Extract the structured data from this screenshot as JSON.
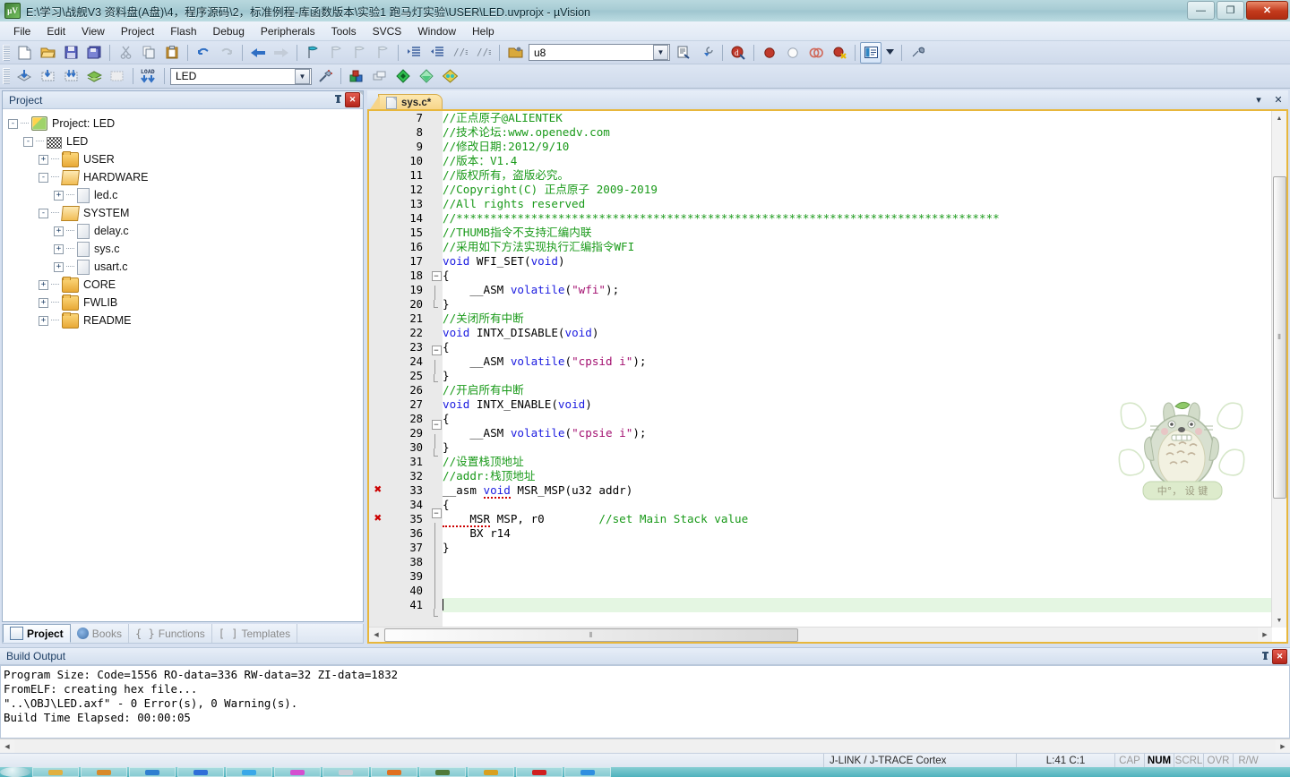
{
  "window": {
    "title": "E:\\学习\\战舰V3 资料盘(A盘)\\4，程序源码\\2，标准例程-库函数版本\\实验1 跑马灯实验\\USER\\LED.uvprojx - µVision",
    "app_icon": "uvision-logo-icon",
    "minimize_label": "—",
    "restore_label": "❐",
    "close_label": "✕"
  },
  "menu": {
    "items": [
      "File",
      "Edit",
      "View",
      "Project",
      "Flash",
      "Debug",
      "Peripherals",
      "Tools",
      "SVCS",
      "Window",
      "Help"
    ]
  },
  "toolbar_row1": {
    "groups": [
      {
        "buttons": [
          {
            "name": "new-file-icon",
            "glyph": "📄"
          },
          {
            "name": "open-file-icon",
            "glyph": "📂"
          },
          {
            "name": "save-icon",
            "glyph": "💾"
          },
          {
            "name": "save-all-icon",
            "glyph": "🗄"
          }
        ]
      },
      {
        "buttons": [
          {
            "name": "cut-icon",
            "glyph": "✂"
          },
          {
            "name": "copy-icon",
            "glyph": "⧉"
          },
          {
            "name": "paste-icon",
            "glyph": "📋"
          }
        ]
      },
      {
        "buttons": [
          {
            "name": "undo-icon",
            "glyph": "↶"
          },
          {
            "name": "redo-icon",
            "glyph": "↷"
          }
        ]
      },
      {
        "buttons": [
          {
            "name": "navigate-back-icon",
            "glyph": "⬅"
          },
          {
            "name": "navigate-forward-icon",
            "glyph": "➡"
          }
        ]
      },
      {
        "buttons": [
          {
            "name": "bookmark-toggle-icon",
            "glyph": "⚑"
          },
          {
            "name": "bookmark-prev-icon",
            "glyph": "⚐"
          },
          {
            "name": "bookmark-next-icon",
            "glyph": "⚐"
          },
          {
            "name": "bookmark-clear-icon",
            "glyph": "⚐"
          }
        ]
      },
      {
        "buttons": [
          {
            "name": "indent-icon",
            "glyph": "⇥"
          },
          {
            "name": "outdent-icon",
            "glyph": "⇤"
          },
          {
            "name": "comment-icon",
            "glyph": "//"
          },
          {
            "name": "uncomment-icon",
            "glyph": "//"
          }
        ]
      }
    ]
  },
  "toolbar_row2": {
    "buttons_left": [
      {
        "name": "build-icon",
        "glyph": "⬒"
      },
      {
        "name": "rebuild-icon",
        "glyph": "⬓"
      },
      {
        "name": "batch-build-icon",
        "glyph": "⬔"
      },
      {
        "name": "translate-icon",
        "glyph": "📚"
      },
      {
        "name": "stop-build-icon",
        "glyph": "⬛"
      }
    ],
    "load_button": {
      "name": "download-to-flash-icon",
      "label": "LOAD"
    },
    "target_combo": {
      "name": "target-select",
      "value": "LED"
    },
    "buttons_right": [
      {
        "name": "target-options-icon",
        "glyph": "🛠"
      },
      {
        "name": "manage-project-items-icon",
        "glyph": "▦"
      },
      {
        "name": "manage-multi-project-icon",
        "glyph": "❏"
      },
      {
        "name": "pack-installer-icon",
        "glyph": "◈"
      },
      {
        "name": "manage-run-time-env-icon",
        "glyph": "◇"
      },
      {
        "name": "select-software-packs-icon",
        "glyph": "◆"
      }
    ],
    "divider_right": [
      {
        "name": "open-folder-icon",
        "glyph": "📁"
      }
    ],
    "search_combo": {
      "name": "find-combo",
      "value": "u8"
    },
    "after_search": [
      {
        "name": "find-in-files-icon",
        "glyph": "🔎"
      },
      {
        "name": "incremental-find-icon",
        "glyph": "🔍"
      }
    ],
    "debug_group": [
      {
        "name": "start-debug-session-icon",
        "glyph": "🅓"
      }
    ],
    "breakpoint_group": [
      {
        "name": "insert-remove-breakpoint-icon",
        "glyph": "●",
        "color": "#cc2222"
      },
      {
        "name": "enable-disable-breakpoint-icon",
        "glyph": "○",
        "color": "#ffffff"
      },
      {
        "name": "disable-all-breakpoints-icon",
        "glyph": "◍",
        "color": "#dd5555"
      },
      {
        "name": "kill-all-breakpoints-icon",
        "glyph": "●",
        "color": "#cc2222"
      }
    ],
    "window_group": [
      {
        "name": "project-window-toggle-icon",
        "glyph": "▤",
        "active": true
      },
      {
        "name": "window-dropdown-icon",
        "glyph": "▾"
      },
      {
        "name": "configuration-wizard-icon",
        "glyph": "🔧"
      }
    ]
  },
  "project_panel": {
    "title": "Project",
    "pin_label": "📌",
    "close_label": "✕",
    "tree": [
      {
        "depth": 0,
        "expander": "-",
        "icon": "project-icon",
        "label": "Project: LED"
      },
      {
        "depth": 1,
        "expander": "-",
        "icon": "target-icon",
        "label": "LED"
      },
      {
        "depth": 2,
        "expander": "+",
        "icon": "folder-icon",
        "label": "USER"
      },
      {
        "depth": 2,
        "expander": "-",
        "icon": "folder-open-icon",
        "label": "HARDWARE"
      },
      {
        "depth": 3,
        "expander": "+",
        "icon": "c-file-icon",
        "label": "led.c"
      },
      {
        "depth": 2,
        "expander": "-",
        "icon": "folder-open-icon",
        "label": "SYSTEM"
      },
      {
        "depth": 3,
        "expander": "+",
        "icon": "c-file-icon",
        "label": "delay.c"
      },
      {
        "depth": 3,
        "expander": "+",
        "icon": "c-file-icon",
        "label": "sys.c"
      },
      {
        "depth": 3,
        "expander": "+",
        "icon": "c-file-icon",
        "label": "usart.c"
      },
      {
        "depth": 2,
        "expander": "+",
        "icon": "folder-icon",
        "label": "CORE"
      },
      {
        "depth": 2,
        "expander": "+",
        "icon": "folder-icon",
        "label": "FWLIB"
      },
      {
        "depth": 2,
        "expander": "+",
        "icon": "folder-icon",
        "label": "README"
      }
    ],
    "tabs": [
      {
        "label": "Project",
        "icon": "project-tab-icon",
        "selected": true
      },
      {
        "label": "Books",
        "icon": "books-tab-icon",
        "selected": false
      },
      {
        "label": "Functions",
        "icon": "functions-tab-icon",
        "prefix": "{ }",
        "selected": false
      },
      {
        "label": "Templates",
        "icon": "templates-tab-icon",
        "prefix": "[ ]",
        "selected": false
      }
    ]
  },
  "editor": {
    "tab": {
      "label": "sys.c*",
      "icon": "c-file-icon"
    },
    "dropdown_label": "▾",
    "close_label": "✕",
    "watermark": {
      "name": "totoro-watermark",
      "caption": "中°， 设 键"
    },
    "first_line_number": 7,
    "highlight_line": 41,
    "error_marker_lines": [
      33,
      35
    ],
    "lines": [
      {
        "n": 7,
        "fold": "",
        "segs": [
          {
            "t": "//正点原子@ALIENTEK",
            "c": "cmt"
          }
        ]
      },
      {
        "n": 8,
        "fold": "",
        "segs": [
          {
            "t": "//技术论坛:www.openedv.com",
            "c": "cmt"
          }
        ]
      },
      {
        "n": 9,
        "fold": "",
        "segs": [
          {
            "t": "//修改日期:2012/9/10",
            "c": "cmt"
          }
        ]
      },
      {
        "n": 10,
        "fold": "",
        "segs": [
          {
            "t": "//版本：V1.4",
            "c": "cmt"
          }
        ]
      },
      {
        "n": 11,
        "fold": "",
        "segs": [
          {
            "t": "//版权所有，盗版必究。",
            "c": "cmt"
          }
        ]
      },
      {
        "n": 12,
        "fold": "",
        "segs": [
          {
            "t": "//Copyright(C) 正点原子 2009-2019",
            "c": "cmt"
          }
        ]
      },
      {
        "n": 13,
        "fold": "",
        "segs": [
          {
            "t": "//All rights reserved",
            "c": "cmt"
          }
        ]
      },
      {
        "n": 14,
        "fold": "",
        "segs": [
          {
            "t": "//********************************************************************************",
            "c": "cmt"
          }
        ]
      },
      {
        "n": 15,
        "fold": "",
        "segs": [
          {
            "t": "//THUMB指令不支持汇编内联",
            "c": "cmt"
          }
        ]
      },
      {
        "n": 16,
        "fold": "",
        "segs": [
          {
            "t": "//采用如下方法实现执行汇编指令WFI",
            "c": "cmt"
          }
        ]
      },
      {
        "n": 17,
        "fold": "",
        "segs": [
          {
            "t": "void",
            "c": "kw"
          },
          {
            "t": " WFI_SET(",
            "c": "pln"
          },
          {
            "t": "void",
            "c": "kw"
          },
          {
            "t": ")",
            "c": "pln"
          }
        ]
      },
      {
        "n": 18,
        "fold": "box",
        "segs": [
          {
            "t": "{",
            "c": "pln"
          }
        ]
      },
      {
        "n": 19,
        "fold": "bar",
        "segs": [
          {
            "t": "    __ASM ",
            "c": "pln"
          },
          {
            "t": "volatile",
            "c": "kw"
          },
          {
            "t": "(",
            "c": "pln"
          },
          {
            "t": "\"wfi\"",
            "c": "str"
          },
          {
            "t": ");",
            "c": "pln"
          }
        ]
      },
      {
        "n": 20,
        "fold": "end",
        "segs": [
          {
            "t": "}",
            "c": "pln"
          }
        ]
      },
      {
        "n": 21,
        "fold": "",
        "segs": [
          {
            "t": "//关闭所有中断",
            "c": "cmt"
          }
        ]
      },
      {
        "n": 22,
        "fold": "",
        "segs": [
          {
            "t": "void",
            "c": "kw"
          },
          {
            "t": " INTX_DISABLE(",
            "c": "pln"
          },
          {
            "t": "void",
            "c": "kw"
          },
          {
            "t": ")",
            "c": "pln"
          }
        ]
      },
      {
        "n": 23,
        "fold": "box",
        "segs": [
          {
            "t": "{",
            "c": "pln"
          }
        ]
      },
      {
        "n": 24,
        "fold": "bar",
        "segs": [
          {
            "t": "    __ASM ",
            "c": "pln"
          },
          {
            "t": "volatile",
            "c": "kw"
          },
          {
            "t": "(",
            "c": "pln"
          },
          {
            "t": "\"cpsid i\"",
            "c": "str"
          },
          {
            "t": ");",
            "c": "pln"
          }
        ]
      },
      {
        "n": 25,
        "fold": "end",
        "segs": [
          {
            "t": "}",
            "c": "pln"
          }
        ]
      },
      {
        "n": 26,
        "fold": "",
        "segs": [
          {
            "t": "//开启所有中断",
            "c": "cmt"
          }
        ]
      },
      {
        "n": 27,
        "fold": "",
        "segs": [
          {
            "t": "void",
            "c": "kw"
          },
          {
            "t": " INTX_ENABLE(",
            "c": "pln"
          },
          {
            "t": "void",
            "c": "kw"
          },
          {
            "t": ")",
            "c": "pln"
          }
        ]
      },
      {
        "n": 28,
        "fold": "box",
        "segs": [
          {
            "t": "{",
            "c": "pln"
          }
        ]
      },
      {
        "n": 29,
        "fold": "bar",
        "segs": [
          {
            "t": "    __ASM ",
            "c": "pln"
          },
          {
            "t": "volatile",
            "c": "kw"
          },
          {
            "t": "(",
            "c": "pln"
          },
          {
            "t": "\"cpsie i\"",
            "c": "str"
          },
          {
            "t": ");",
            "c": "pln"
          }
        ]
      },
      {
        "n": 30,
        "fold": "end",
        "segs": [
          {
            "t": "}",
            "c": "pln"
          }
        ]
      },
      {
        "n": 31,
        "fold": "",
        "segs": [
          {
            "t": "//设置栈顶地址",
            "c": "cmt"
          }
        ]
      },
      {
        "n": 32,
        "fold": "",
        "segs": [
          {
            "t": "//addr:栈顶地址",
            "c": "cmt"
          }
        ]
      },
      {
        "n": 33,
        "fold": "",
        "segs": [
          {
            "t": "__asm ",
            "c": "pln"
          },
          {
            "t": "void",
            "c": "kw",
            "sq": true
          },
          {
            "t": " MSR_MSP(u32 addr)",
            "c": "pln"
          }
        ]
      },
      {
        "n": 34,
        "fold": "box",
        "segs": [
          {
            "t": "{",
            "c": "pln"
          }
        ]
      },
      {
        "n": 35,
        "fold": "bar",
        "segs": [
          {
            "t": "    MSR",
            "c": "pln",
            "sq": true
          },
          {
            "t": " MSP, r0        ",
            "c": "pln"
          },
          {
            "t": "//set Main Stack value",
            "c": "cmt"
          }
        ]
      },
      {
        "n": 36,
        "fold": "bar",
        "segs": [
          {
            "t": "    BX r14",
            "c": "pln"
          }
        ]
      },
      {
        "n": 37,
        "fold": "bar",
        "segs": [
          {
            "t": "}",
            "c": "pln"
          }
        ]
      },
      {
        "n": 38,
        "fold": "bar",
        "segs": [
          {
            "t": "",
            "c": "pln"
          }
        ]
      },
      {
        "n": 39,
        "fold": "bar",
        "segs": [
          {
            "t": "",
            "c": "pln"
          }
        ]
      },
      {
        "n": 40,
        "fold": "bar",
        "segs": [
          {
            "t": "",
            "c": "pln"
          }
        ]
      },
      {
        "n": 41,
        "fold": "end",
        "segs": [
          {
            "t": "",
            "c": "pln"
          }
        ]
      }
    ]
  },
  "build_output": {
    "title": "Build Output",
    "pin_label": "📌",
    "close_label": "✕",
    "lines": [
      "Program Size: Code=1556 RO-data=336 RW-data=32 ZI-data=1832",
      "FromELF: creating hex file...",
      "\"..\\OBJ\\LED.axf\" - 0 Error(s), 0 Warning(s).",
      "Build Time Elapsed:  00:00:05"
    ]
  },
  "status_bar": {
    "debugger": "J-LINK / J-TRACE Cortex",
    "cursor_position": "L:41 C:1",
    "flags": [
      {
        "label": "CAP",
        "on": false
      },
      {
        "label": "NUM",
        "on": true
      },
      {
        "label": "SCRL",
        "on": false
      },
      {
        "label": "OVR",
        "on": false
      },
      {
        "label": "R/W",
        "on": false
      }
    ]
  },
  "taskbar": {
    "start_label": "",
    "items": [
      "",
      "",
      "",
      "",
      "",
      "",
      "",
      "",
      "",
      "",
      "",
      ""
    ]
  },
  "colors": {
    "comment": "#1a9a1a",
    "keyword": "#1c1ce0",
    "string": "#a31070",
    "error_marker": "#cc0000",
    "editor_border": "#e8b73c",
    "highlight_line": "#e4f6e2"
  }
}
